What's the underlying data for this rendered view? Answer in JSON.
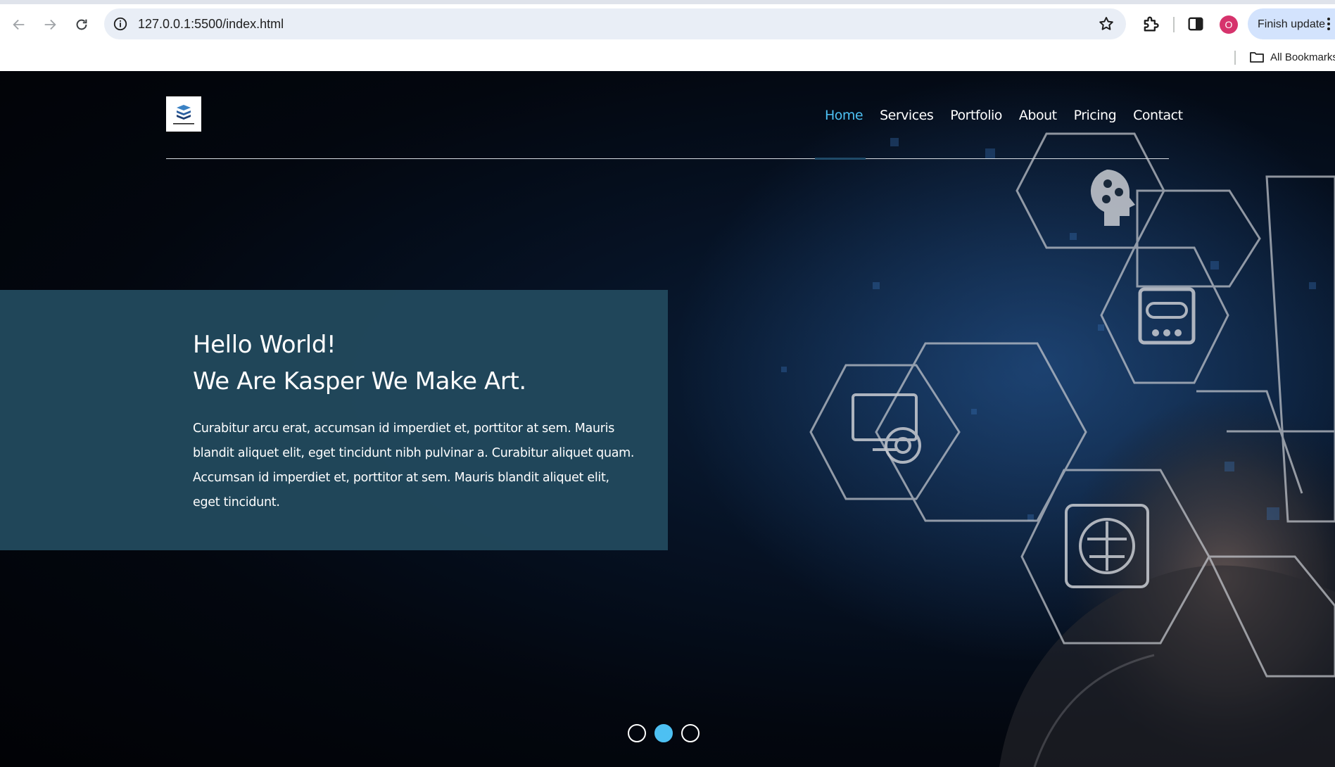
{
  "browser": {
    "url": "127.0.0.1:5500/index.html",
    "profile_initial": "O",
    "finish_update_label": "Finish update",
    "bookmarks_label": "All Bookmarks"
  },
  "site": {
    "nav": {
      "items": [
        {
          "label": "Home",
          "active": true
        },
        {
          "label": "Services",
          "active": false
        },
        {
          "label": "Portfolio",
          "active": false
        },
        {
          "label": "About",
          "active": false
        },
        {
          "label": "Pricing",
          "active": false
        },
        {
          "label": "Contact",
          "active": false
        }
      ]
    },
    "hero": {
      "title_line1": "Hello World!",
      "title_line2": "We Are Kasper We Make Art.",
      "body": "Curabitur arcu erat, accumsan id imperdiet et, porttitor at sem. Mauris blandit aliquet elit, eget tincidunt nibh pulvinar a. Curabitur aliquet quam. Accumsan id imperdiet et, porttitor at sem. Mauris blandit aliquet elit, eget tincidunt.",
      "slider": {
        "count": 3,
        "active_index": 1
      }
    },
    "colors": {
      "accent": "#4dc0f2",
      "panel": "#21485c",
      "background": "#03070f"
    }
  }
}
